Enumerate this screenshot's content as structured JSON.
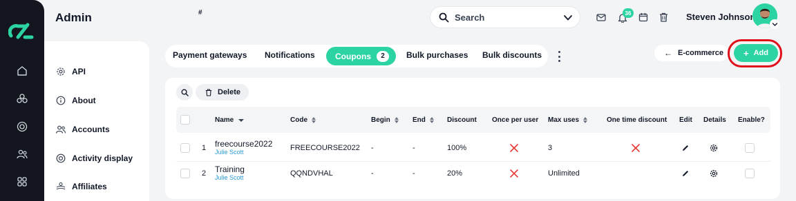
{
  "header": {
    "title": "Admin",
    "search_label": "Search",
    "notification_count": "36",
    "user_name": "Steven Johnson"
  },
  "rail": {
    "icons": [
      "home-icon",
      "modules-icon",
      "target-icon",
      "users-icon",
      "grid-icon"
    ]
  },
  "side_menu": {
    "items": [
      {
        "label": "API",
        "icon": "gear-icon"
      },
      {
        "label": "About",
        "icon": "info-icon"
      },
      {
        "label": "Accounts",
        "icon": "users-icon"
      },
      {
        "label": "Activity display",
        "icon": "target-icon"
      },
      {
        "label": "Affiliates",
        "icon": "affiliates-icon"
      }
    ]
  },
  "tabs": {
    "items": [
      "Payment gateways",
      "Notifications",
      "Coupons",
      "Bulk purchases",
      "Bulk discounts"
    ],
    "active": "Coupons",
    "active_count": "2"
  },
  "actions": {
    "back_label": "E-commerce",
    "add_label": "Add",
    "delete_label": "Delete"
  },
  "table": {
    "columns": [
      "#",
      "Name",
      "Code",
      "Begin",
      "End",
      "Discount",
      "Once per user",
      "Max uses",
      "One time discount",
      "Edit",
      "Details",
      "Enable?"
    ],
    "rows": [
      {
        "num": "1",
        "name": "freecourse2022",
        "owner": "Julie Scott",
        "code": "FREECOURSE2022",
        "begin": "-",
        "end": "-",
        "discount": "100%",
        "max_uses": "3"
      },
      {
        "num": "2",
        "name": "Training",
        "owner": "Julie Scott",
        "code": "QQNDVHAL",
        "begin": "-",
        "end": "-",
        "discount": "20%",
        "max_uses": "Unlimited"
      }
    ]
  },
  "colors": {
    "accent": "#2dd4a3",
    "highlight": "#e0101a",
    "rail": "#13161f",
    "link": "#2b9bd4",
    "cross": "#e53935"
  }
}
